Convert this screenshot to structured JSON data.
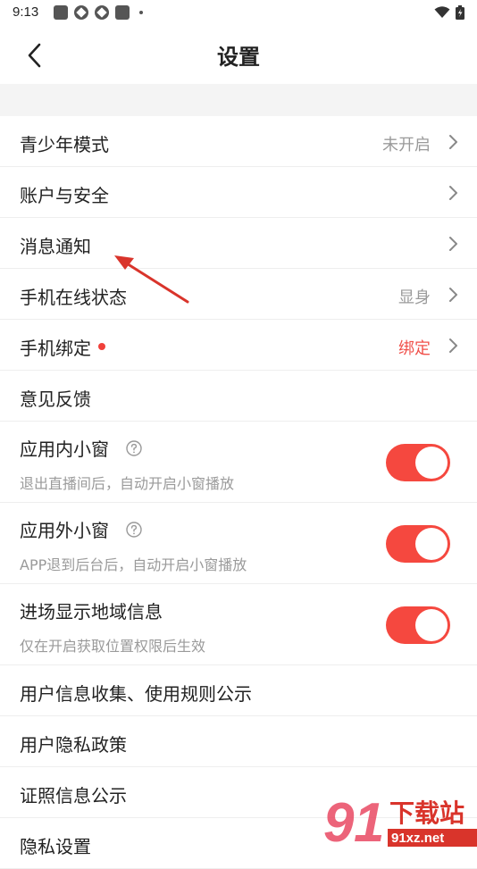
{
  "status_bar": {
    "time": "9:13"
  },
  "header": {
    "title": "设置",
    "back_icon": "chevron-left-icon"
  },
  "settings": [
    {
      "label": "青少年模式",
      "value": "未开启",
      "has_chevron": true
    },
    {
      "label": "账户与安全",
      "has_chevron": true
    },
    {
      "label": "消息通知",
      "has_chevron": true
    },
    {
      "label": "手机在线状态",
      "value": "显身",
      "has_chevron": true
    },
    {
      "label": "手机绑定",
      "value": "绑定",
      "value_color": "#f0504a",
      "badge": "red-dot",
      "has_chevron": true
    },
    {
      "label": "意见反馈"
    },
    {
      "label": "应用内小窗",
      "subtitle": "退出直播间后，自动开启小窗播放",
      "help_icon": true,
      "toggle_on": true
    },
    {
      "label": "应用外小窗",
      "subtitle": "APP退到后台后，自动开启小窗播放",
      "help_icon": true,
      "toggle_on": true
    },
    {
      "label": "进场显示地域信息",
      "subtitle": "仅在开启获取位置权限后生效",
      "toggle_on": true
    },
    {
      "label": "用户信息收集、使用规则公示"
    },
    {
      "label": "用户隐私政策"
    },
    {
      "label": "证照信息公示"
    },
    {
      "label": "隐私设置"
    }
  ],
  "colors": {
    "accent": "#f5483f",
    "value_gray": "#9a9a9a",
    "section_bg": "#f4f4f4"
  },
  "watermark": {
    "text": "下载站",
    "domain": "91xz.net"
  }
}
